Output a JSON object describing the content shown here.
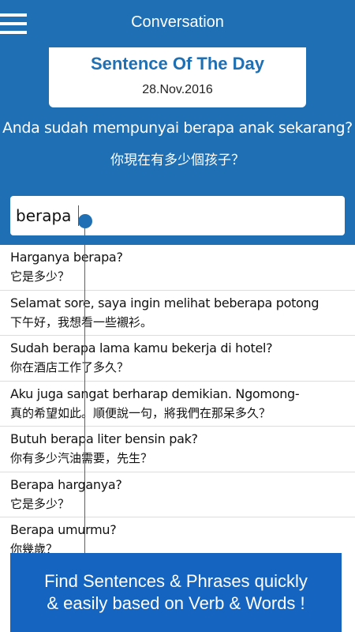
{
  "app_bar": {
    "title": "Conversation",
    "menu_icon": "hamburger-menu-icon"
  },
  "sentence_of_day": {
    "title": "Sentence Of The Day",
    "date": "28.Nov.2016",
    "sentence_id": "Anda sudah mempunyai berapa anak sekarang?",
    "sentence_zh": "你現在有多少個孩子？"
  },
  "search": {
    "value": "berapa"
  },
  "results": [
    {
      "id": "Harganya berapa?",
      "zh": "它是多少？"
    },
    {
      "id": "Selamat sore, saya ingin melihat beberapa potong",
      "zh": "下午好，我想看一些襯衫。"
    },
    {
      "id": "Sudah berapa lama kamu bekerja di hotel?",
      "zh": "你在酒店工作了多久？"
    },
    {
      "id": "Aku juga sangat berharap demikian. Ngomong-",
      "zh": "真的希望如此。順便說一句，將我們在那呆多久？"
    },
    {
      "id": "Butuh berapa liter bensin pak?",
      "zh": "你有多少汽油需要，先生？"
    },
    {
      "id": "Berapa harganya?",
      "zh": "它是多少？"
    },
    {
      "id": "Berapa umurmu?",
      "zh": "你幾歲？"
    }
  ],
  "banner": {
    "line1": "Find Sentences & Phrases quickly",
    "line2": "& easily based on Verb & Words !"
  },
  "colors": {
    "primary": "#1e6fb3",
    "banner": "#1565c0"
  }
}
